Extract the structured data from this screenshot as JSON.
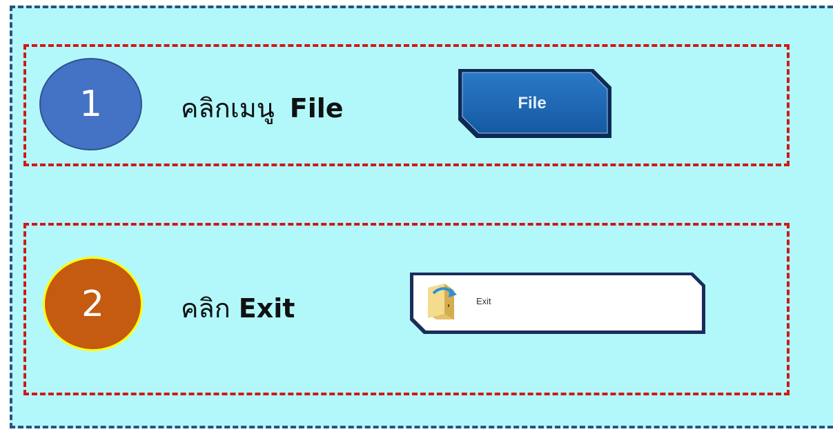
{
  "steps": [
    {
      "number": "1",
      "text": "คลิกเมนู",
      "keyword": "File",
      "button_label": "File"
    },
    {
      "number": "2",
      "text": "คลิก",
      "keyword": "Exit",
      "menu_item_label": "Exit"
    }
  ],
  "colors": {
    "panel_bg": "#b2f8fb",
    "panel_border": "#2f4f7f",
    "step_border": "#d01818",
    "circle_1": "#4472c4",
    "circle_2": "#c55a11",
    "file_button": "#1f5fa8"
  },
  "icons": {
    "exit": "folder-exit-icon"
  }
}
